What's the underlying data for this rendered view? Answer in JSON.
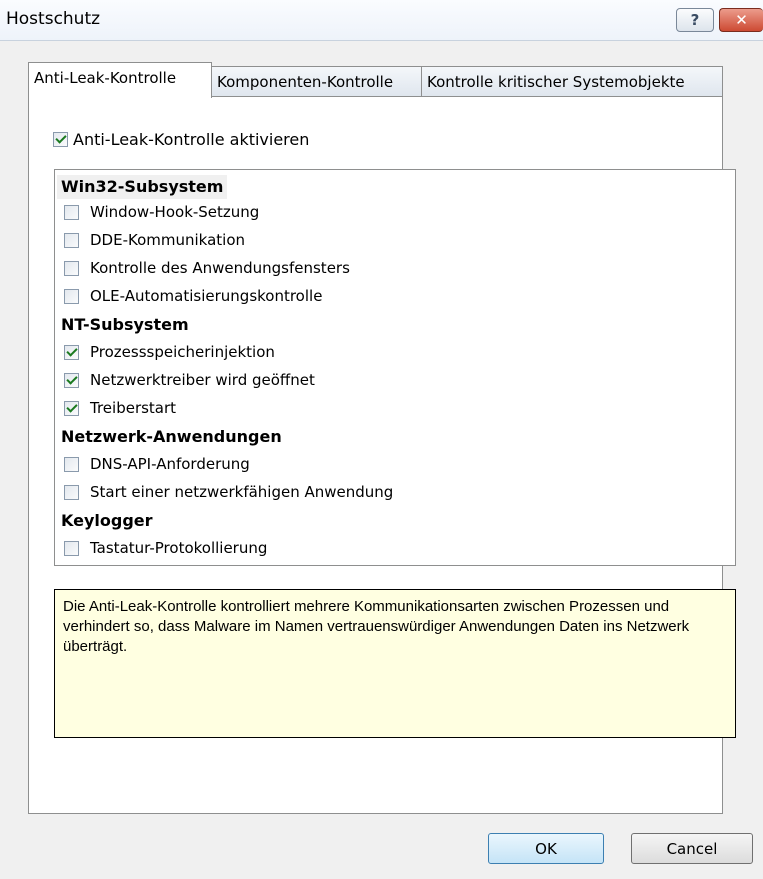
{
  "window": {
    "title": "Hostschutz",
    "help_label": "?",
    "close_label": "✕"
  },
  "tabs": [
    {
      "label": "Anti-Leak-Kontrolle",
      "active": true
    },
    {
      "label": "Komponenten-Kontrolle",
      "active": false
    },
    {
      "label": "Kontrolle kritischer Systemobjekte",
      "active": false
    }
  ],
  "enable": {
    "label": "Anti-Leak-Kontrolle aktivieren",
    "checked": true
  },
  "groups": [
    {
      "name": "Win32-Subsystem",
      "items": [
        {
          "label": "Window-Hook-Setzung",
          "checked": false
        },
        {
          "label": "DDE-Kommunikation",
          "checked": false
        },
        {
          "label": "Kontrolle des Anwendungsfensters",
          "checked": false
        },
        {
          "label": "OLE-Automatisierungskontrolle",
          "checked": false
        }
      ]
    },
    {
      "name": "NT-Subsystem",
      "items": [
        {
          "label": "Prozessspeicherinjektion",
          "checked": true
        },
        {
          "label": "Netzwerktreiber wird geöffnet",
          "checked": true
        },
        {
          "label": "Treiberstart",
          "checked": true
        }
      ]
    },
    {
      "name": "Netzwerk-Anwendungen",
      "items": [
        {
          "label": "DNS-API-Anforderung",
          "checked": false
        },
        {
          "label": "Start einer netzwerkfähigen Anwendung",
          "checked": false
        }
      ]
    },
    {
      "name": "Keylogger",
      "items": [
        {
          "label": "Tastatur-Protokollierung",
          "checked": false
        }
      ]
    }
  ],
  "info": {
    "text": "Die Anti-Leak-Kontrolle kontrolliert mehrere Kommunikationsarten zwischen Prozessen und verhindert so, dass Malware im Namen vertrauenswürdiger Anwendungen Daten ins Netzwerk überträgt."
  },
  "buttons": {
    "ok": "OK",
    "cancel": "Cancel"
  }
}
